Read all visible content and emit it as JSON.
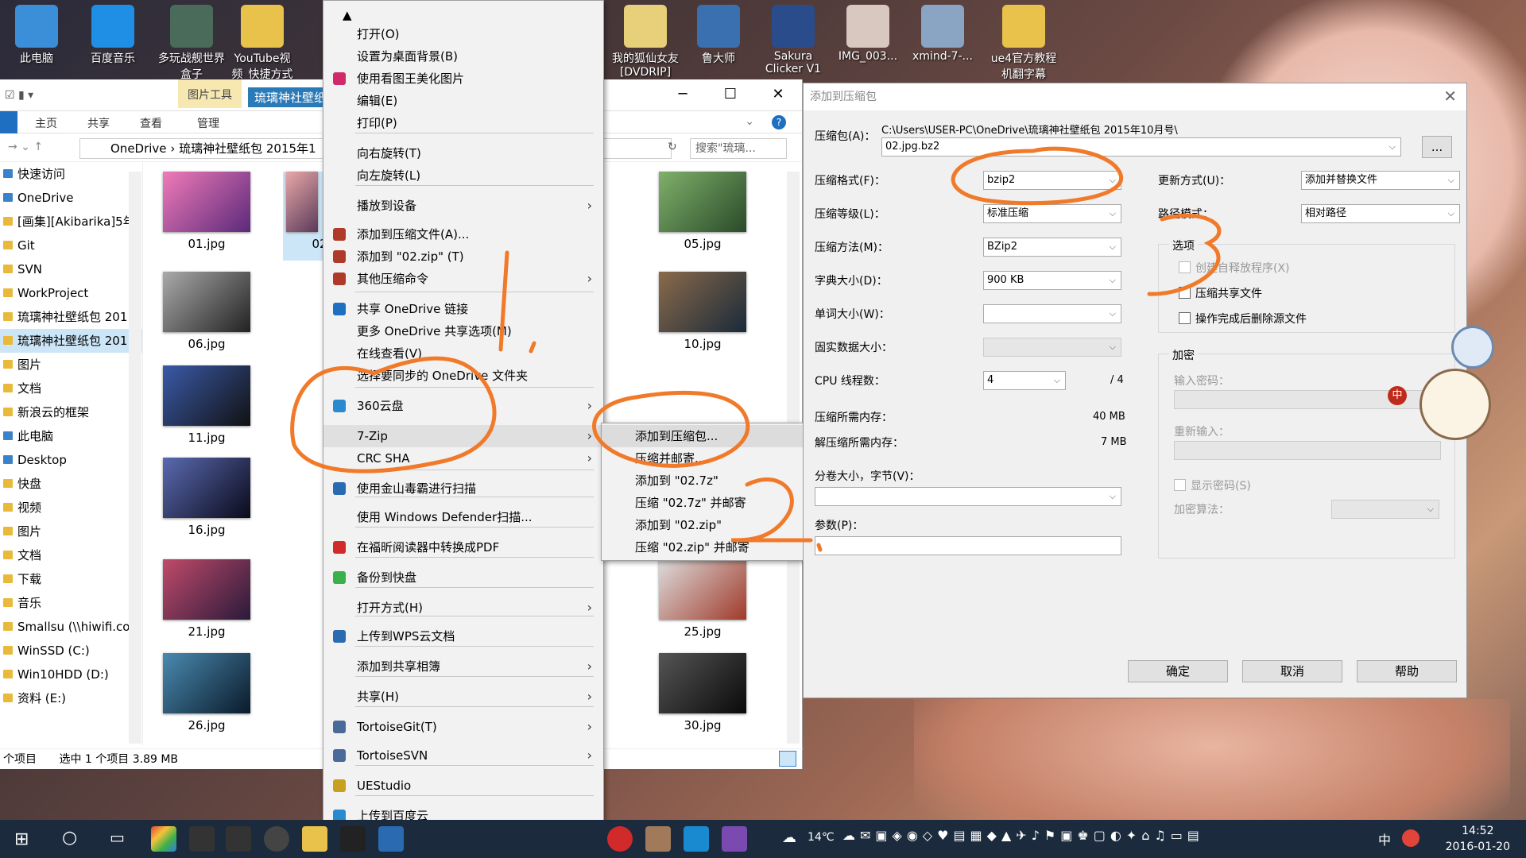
{
  "desktop": {
    "icons": [
      "此电脑",
      "百度音乐",
      "多玩战舰世界盒子",
      "YouTube视频_快捷方式",
      "",
      "我的狐仙女友[DVDRIP]",
      "鲁大师",
      "Sakura Clicker V1",
      "IMG_003...",
      "xmind-7-...",
      "ue4官方教程机翻字幕"
    ]
  },
  "explorer": {
    "tool_tab": "图片工具",
    "title": "琉璃神社壁纸包 2015年10月号",
    "ribbon": [
      "主页",
      "共享",
      "查看",
      "管理"
    ],
    "path": [
      "OneDrive",
      "琉璃神社壁纸包 2015年1"
    ],
    "search_placeholder": "搜索\"琉璃...",
    "nav": [
      "快速访问",
      "OneDrive",
      "[画集][Akibarika]5年",
      "Git",
      "SVN",
      "WorkProject",
      "琉璃神社壁纸包 201",
      "琉璃神社壁纸包 201",
      "图片",
      "文档",
      "新浪云的框架",
      "此电脑",
      "Desktop",
      "快盘",
      "视频",
      "图片",
      "文档",
      "下载",
      "音乐",
      "Smallsu (\\\\hiwifi.co",
      "WinSSD (C:)",
      "Win10HDD (D:)",
      "资料 (E:)"
    ],
    "files": [
      "01.jpg",
      "02.jpg",
      "05.jpg",
      "06.jpg",
      "10.jpg",
      "11.jpg",
      "16.jpg",
      "21.jpg",
      "25.jpg",
      "26.jpg",
      "30.jpg"
    ],
    "status_items": "个项目",
    "status_sel": "选中 1 个项目  3.89 MB"
  },
  "context_menu": {
    "items": [
      "打开(O)",
      "设置为桌面背景(B)",
      "使用看图王美化图片",
      "编辑(E)",
      "打印(P)",
      "向右旋转(T)",
      "向左旋转(L)",
      "播放到设备",
      "添加到压缩文件(A)...",
      "添加到 \"02.zip\" (T)",
      "其他压缩命令",
      "共享 OneDrive 链接",
      "更多 OneDrive 共享选项(M)",
      "在线查看(V)",
      "选择要同步的 OneDrive 文件夹",
      "360云盘",
      "7-Zip",
      "CRC SHA",
      "使用金山毒霸进行扫描",
      "使用 Windows Defender扫描...",
      "在福昕阅读器中转换成PDF",
      "备份到快盘",
      "打开方式(H)",
      "上传到WPS云文档",
      "添加到共享相簿",
      "共享(H)",
      "TortoiseGit(T)",
      "TortoiseSVN",
      "UEStudio",
      "上传到百度云"
    ]
  },
  "submenu_7zip": [
    "添加到压缩包...",
    "压缩并邮寄...",
    "添加到 \"02.7z\"",
    "压缩 \"02.7z\" 并邮寄",
    "添加到 \"02.zip\"",
    "压缩 \"02.zip\" 并邮寄"
  ],
  "dialog": {
    "title": "添加到压缩包",
    "archive_label": "压缩包(A)：",
    "archive_path": "C:\\Users\\USER-PC\\OneDrive\\琉璃神社壁纸包 2015年10月号\\",
    "archive_name": "02.jpg.bz2",
    "browse": "...",
    "format_label": "压缩格式(F)：",
    "format": "bzip2",
    "level_label": "压缩等级(L)：",
    "level": "标准压缩",
    "method_label": "压缩方法(M)：",
    "method": "BZip2",
    "dict_label": "字典大小(D)：",
    "dict": "900 KB",
    "word_label": "单词大小(W)：",
    "solid_label": "固实数据大小：",
    "cpu_label": "CPU 线程数：",
    "cpu": "4",
    "cpu_max": "/ 4",
    "mem_c_label": "压缩所需内存：",
    "mem_c": "40 MB",
    "mem_d_label": "解压缩所需内存：",
    "mem_d": "7 MB",
    "split_label": "分卷大小，字节(V)：",
    "params_label": "参数(P)：",
    "update_label": "更新方式(U)：",
    "update": "添加并替换文件",
    "pathmode_label": "路径模式：",
    "pathmode": "相对路径",
    "options_label": "选项",
    "opt1": "创建自释放程序(X)",
    "opt2": "压缩共享文件",
    "opt3": "操作完成后删除源文件",
    "enc_label": "加密",
    "pw_label": "输入密码：",
    "pw2_label": "重新输入：",
    "show_pw": "显示密码(S)",
    "enc_method_label": "加密算法：",
    "ok": "确定",
    "cancel": "取消",
    "help": "帮助"
  },
  "taskbar": {
    "weather": "14℃",
    "time": "14:52",
    "date": "2016-01-20",
    "ime": "中"
  }
}
